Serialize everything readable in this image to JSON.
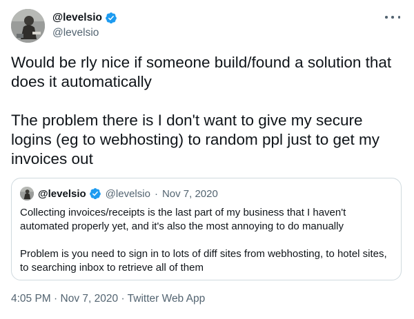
{
  "author": {
    "name": "@levelsio",
    "handle": "@levelsio",
    "verified_icon": "verified-badge-icon"
  },
  "more_icon": "more-horizontal-icon",
  "tweet": {
    "text": "Would be rly nice if someone build/found a solution that does it automatically\n\nThe problem there is I don't want to give my secure logins (eg to webhosting) to random ppl just to get my invoices out"
  },
  "quoted": {
    "name": "@levelsio",
    "handle": "@levelsio",
    "separator": "·",
    "date": "Nov 7, 2020",
    "text": "Collecting invoices/receipts is the last part of my business that I haven't automated properly yet, and it's also the most annoying to do manually\n\nProblem is you need to sign in to lots of diff sites from webhosting, to hotel sites, to searching inbox to retrieve all of them"
  },
  "footer": {
    "time": "4:05 PM",
    "date": "Nov 7, 2020",
    "source": "Twitter Web App",
    "separator": "·"
  },
  "colors": {
    "verified": "#1d9bf0",
    "secondary_text": "#536471",
    "border": "#cfd9de"
  }
}
